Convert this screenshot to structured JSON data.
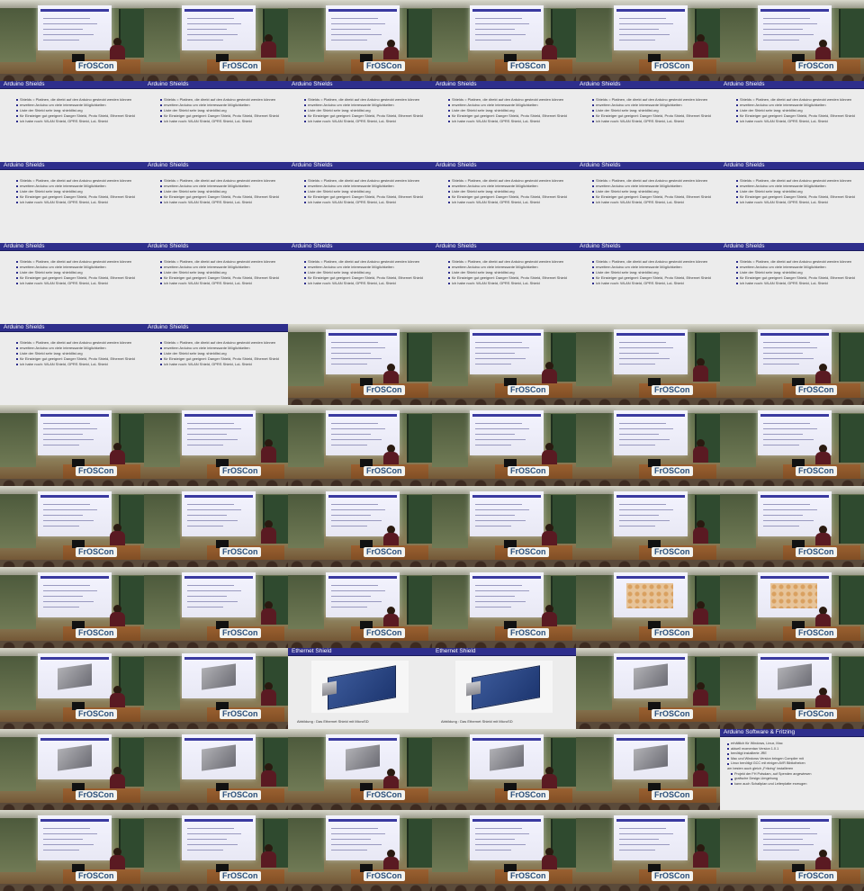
{
  "contact_sheet": {
    "columns": 6,
    "rows": 11,
    "stage_logo": "FrOSCon",
    "arduino_shields_slide": {
      "title": "Arduino Shields",
      "bullets": [
        "Shields = Platinen, die direkt auf den Arduino gesteckt werden können",
        "erweitern Arduino um viele interessante Möglichkeiten",
        "Liste der Shield sehr lang: shieldlist.org",
        "für Einsteiger gut geeignet: Danger Shield, Proto Shield, Ethernet Shield",
        "ich habe noch: WLAN Shield, GPRS Shield, LoL Shield"
      ]
    },
    "ethernet_shield_slide": {
      "title": "Ethernet Shield",
      "caption": "Abbildung : Das Ethernet Shield mit MicroSD"
    },
    "software_slide": {
      "title": "Arduino Software & Fritzing",
      "bullets": [
        "erhältlich für Windows, Linux, Mac",
        "aktuell momentan Version 1.0.1",
        "benötigt installierte JRE",
        "Mac und Windows Version bringen Compiler mit",
        "Linux benötigt GCC mit einigen AVR Bibliotheken",
        "am besten auch gleich „Fritzing“ installieren",
        "Projekt der FH Potsdam, auf Spenden angewiesen",
        "grafische Design-Umgebung",
        "kann auch Schaltplan und Leiterplatte erzeugen"
      ]
    },
    "frames": [
      "stage",
      "stage",
      "stage",
      "stage",
      "stage",
      "stage",
      "shields",
      "shields",
      "shields",
      "shields",
      "shields",
      "shields",
      "shields",
      "shields",
      "shields",
      "shields",
      "shields",
      "shields",
      "shields",
      "shields",
      "shields",
      "shields",
      "shields",
      "shields",
      "shields",
      "shields",
      "stage",
      "stage",
      "stage",
      "stage",
      "stage",
      "stage",
      "stage",
      "stage",
      "stage",
      "stage",
      "stage",
      "stage",
      "stage",
      "stage",
      "stage",
      "stage",
      "stage",
      "stage",
      "stage",
      "stage",
      "stage-orange",
      "stage-orange",
      "stage-board",
      "stage-board",
      "ethernet",
      "ethernet",
      "stage-board",
      "stage-board",
      "stage-board",
      "stage-board",
      "stage-board",
      "stage-board",
      "stage-board",
      "software",
      "stage",
      "stage",
      "stage",
      "stage",
      "stage",
      "stage"
    ]
  }
}
